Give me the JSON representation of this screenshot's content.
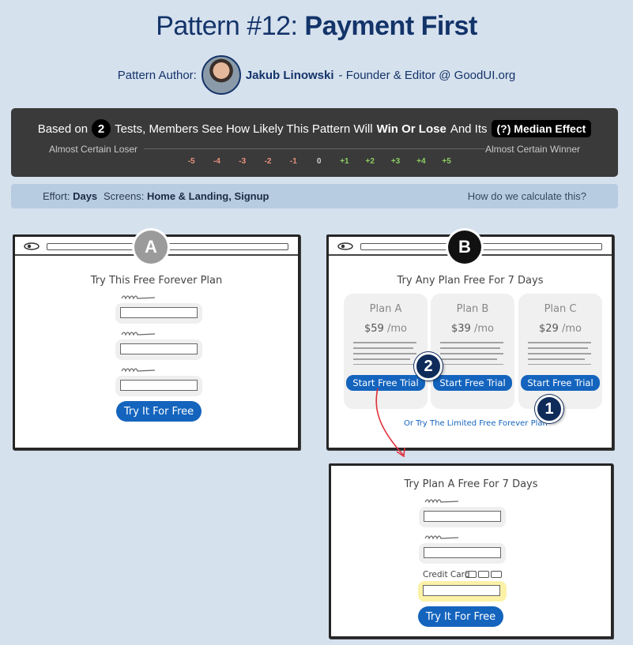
{
  "header": {
    "title_prefix": "Pattern #12:",
    "title_name": "Payment First",
    "author_label": "Pattern Author:",
    "author_name": "Jakub Linowski",
    "author_role": "- Founder & Editor @ GoodUI.org"
  },
  "effect": {
    "based_on": "Based on",
    "tests_count": "2",
    "tests_text": "Tests, Members See How Likely This Pattern Will",
    "win_lose": "Win Or Lose",
    "and_its": "And Its",
    "median_badge": "(?) Median Effect",
    "loser_label": "Almost Certain Loser",
    "winner_label": "Almost Certain Winner",
    "scale": [
      "-5",
      "-4",
      "-3",
      "-2",
      "-1",
      "0",
      "+1",
      "+2",
      "+3",
      "+4",
      "+5"
    ]
  },
  "info": {
    "effort_label": "Effort:",
    "effort_value": "Days",
    "screens_label": "Screens:",
    "screens_value": "Home & Landing, Signup",
    "calc_link": "How do we calculate this?"
  },
  "variant_a": {
    "badge": "A",
    "heading": "Try This Free Forever Plan",
    "cta": "Try It For Free"
  },
  "variant_b": {
    "badge": "B",
    "heading": "Try Any Plan Free For 7 Days",
    "plans": [
      {
        "name": "Plan A",
        "price": "$59",
        "per": "/mo",
        "cta": "Start Free Trial"
      },
      {
        "name": "Plan B",
        "price": "$39",
        "per": "/mo",
        "cta": "Start Free Trial"
      },
      {
        "name": "Plan C",
        "price": "$29",
        "per": "/mo",
        "cta": "Start Free Trial"
      }
    ],
    "free_link": "Or Try The Limited Free Forever Plan",
    "step1": "1",
    "step2": "2"
  },
  "variant_b_next": {
    "heading": "Try Plan A Free For 7 Days",
    "cc_label": "Credit Card",
    "cta": "Try It For Free"
  },
  "colors": {
    "background": "#d6e1ee",
    "title": "#133469",
    "panel": "#3a3a3a",
    "cta_blue": "#1464be",
    "negative": "#e8927c",
    "positive": "#8cce62",
    "highlight_field": "#fbf2a8",
    "arrow_red": "#e0303a"
  }
}
